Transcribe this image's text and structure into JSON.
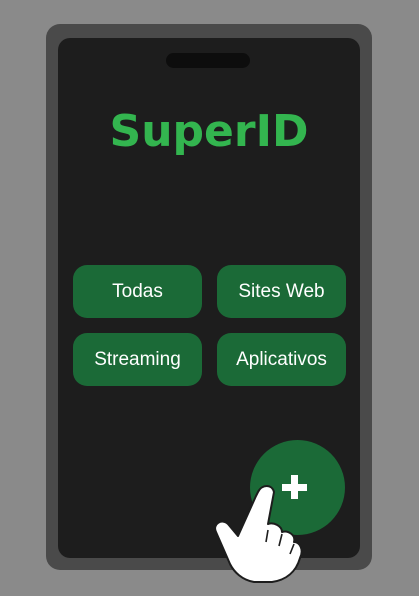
{
  "app": {
    "title": "SuperID"
  },
  "categories": [
    {
      "label": "Todas"
    },
    {
      "label": "Sites Web"
    },
    {
      "label": "Streaming"
    },
    {
      "label": "Aplicativos"
    }
  ],
  "fab": {
    "icon": "plus-icon"
  },
  "colors": {
    "background": "#8a8a8a",
    "phone_frame": "#4a4a4a",
    "screen": "#1d1d1d",
    "accent_green": "#33b54f",
    "button_green": "#1b6a37",
    "text": "#ffffff"
  }
}
